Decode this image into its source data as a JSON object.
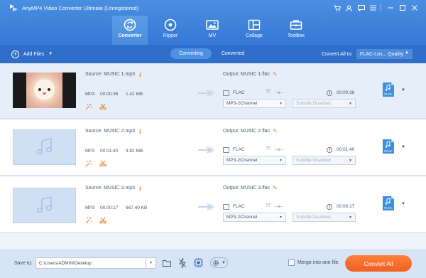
{
  "app": {
    "title": "AnyMP4 Video Converter Ultimate (Unregistered)",
    "window_icons": [
      "cart-icon",
      "user-icon",
      "message-icon",
      "menu-icon",
      "minimize-icon",
      "maximize-icon",
      "close-icon"
    ]
  },
  "nav": {
    "tabs": [
      {
        "label": "Converter",
        "icon": "converter-icon",
        "active": true
      },
      {
        "label": "Ripper",
        "icon": "ripper-icon",
        "active": false
      },
      {
        "label": "MV",
        "icon": "mv-icon",
        "active": false
      },
      {
        "label": "Collage",
        "icon": "collage-icon",
        "active": false
      },
      {
        "label": "Toolbox",
        "icon": "toolbox-icon",
        "active": false
      }
    ]
  },
  "toolbar": {
    "add_files": "Add Files",
    "converting": "Converting",
    "converted": "Converted",
    "convert_all_to": "Convert All to:",
    "format_value": "FLAC-Los... Quality"
  },
  "files": [
    {
      "source": "Source: MUSIC 1.mp3",
      "format": "MP3",
      "duration": "00:00:36",
      "size": "1.42 MB",
      "output": "Output: MUSIC 1.flac",
      "out_format": "FLAC",
      "resolution": "--x--",
      "out_duration": "00:00:36",
      "audio_track": "MP3-2Channel",
      "subtitle": "Subtitle Disabled",
      "badge": "FLAC",
      "thumbnail": "video"
    },
    {
      "source": "Source: MUSIC 2.mp3",
      "format": "MP3",
      "duration": "00:01:40",
      "size": "3.82 MB",
      "output": "Output: MUSIC 2.flac",
      "out_format": "FLAC",
      "resolution": "--x--",
      "out_duration": "00:01:40",
      "audio_track": "MP3-2Channel",
      "subtitle": "Subtitle Disabled",
      "badge": "FLAC",
      "thumbnail": "audio"
    },
    {
      "source": "Source: MUSIC 3.mp3",
      "format": "MP3",
      "duration": "00:00:17",
      "size": "667.40 KB",
      "output": "Output: MUSIC 3.flac",
      "out_format": "FLAC",
      "resolution": "--x--",
      "out_duration": "00:00:17",
      "audio_track": "MP3-2Channel",
      "subtitle": "Subtitle Disabled",
      "badge": "FLAC",
      "thumbnail": "audio"
    }
  ],
  "footer": {
    "save_to": "Save to:",
    "path": "C:\\Users\\ADMIN\\Desktop",
    "merge_label": "Merge into one file",
    "merge_checked": false,
    "convert_all": "Convert All"
  },
  "colors": {
    "header": "#3d82db",
    "toolbar": "#2f6fc9",
    "accent_orange": "#f26a24",
    "selected_row": "#e6eef9"
  }
}
